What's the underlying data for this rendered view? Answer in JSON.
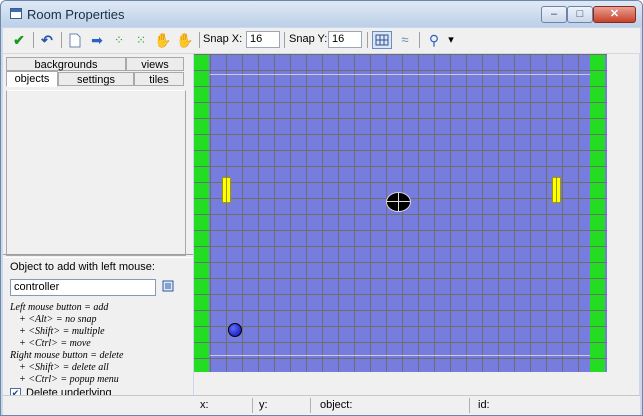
{
  "window": {
    "title": "Room Properties",
    "min": "–",
    "max": "□",
    "close": "✕"
  },
  "toolbar": {
    "icons": [
      "ok-check-icon",
      "undo-icon",
      "new-doc-icon",
      "shift-arrow-icon",
      "flip-h-icon",
      "flip-v-icon",
      "sort-x-icon",
      "sort-y-icon"
    ],
    "snap_x_label": "Snap X:",
    "snap_x_value": "16",
    "snap_y_label": "Snap Y:",
    "snap_y_value": "16",
    "show_grid": true,
    "zoom_label": "▾"
  },
  "tabs": {
    "row_back": [
      "backgrounds",
      "views"
    ],
    "row_front": [
      "objects",
      "settings",
      "tiles"
    ],
    "active": "objects"
  },
  "objects_panel": {
    "add_label": "Object to add with left mouse:",
    "object_value": "controller",
    "help_lines": [
      "Left mouse button = add",
      "+ <Alt> = no snap",
      "+ <Shift> = multiple",
      "+ <Ctrl> = move",
      "Right mouse button = delete",
      "+ <Shift> = delete all",
      "+ <Ctrl> = popup menu"
    ],
    "delete_underlying_label": "Delete underlying",
    "delete_underlying_checked": true
  },
  "room": {
    "background_color": "#777cdf",
    "wall_color": "#22dd22",
    "paddle_color": "#ffff00"
  },
  "statusbar": {
    "x_label": "x:",
    "y_label": "y:",
    "object_label": "object:",
    "id_label": "id:"
  }
}
